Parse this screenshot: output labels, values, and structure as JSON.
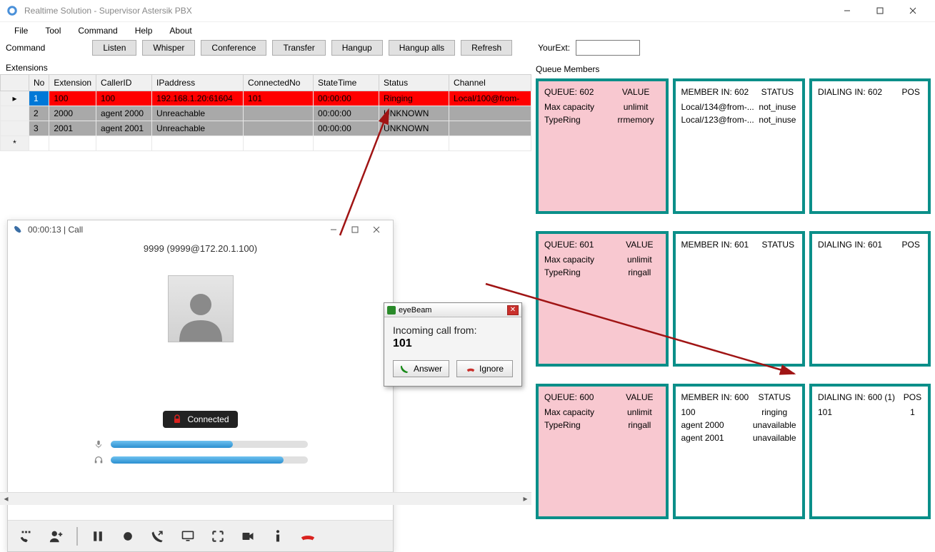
{
  "window": {
    "title": "Realtime Solution - Supervisor Astersik PBX"
  },
  "menubar": [
    "File",
    "Tool",
    "Command",
    "Help",
    "About"
  ],
  "toolbar": {
    "label": "Command",
    "listen": "Listen",
    "whisper": "Whisper",
    "conference": "Conference",
    "transfer": "Transfer",
    "hangup": "Hangup",
    "hangup_alls": "Hangup alls",
    "refresh": "Refresh",
    "yourext_label": "YourExt:",
    "yourext_value": ""
  },
  "extensions": {
    "label": "Extensions",
    "headers": [
      "No",
      "Extension",
      "CallerID",
      "IPaddress",
      "ConnectedNo",
      "StateTime",
      "Status",
      "Channel"
    ],
    "rows": [
      {
        "no": "1",
        "ext": "100",
        "cid": "100",
        "ip": "192.168.1.20:61604",
        "conn": "101",
        "time": "00:00:00",
        "status": "Ringing",
        "chan": "Local/100@from-"
      },
      {
        "no": "2",
        "ext": "2000",
        "cid": "agent 2000",
        "ip": "Unreachable",
        "conn": "",
        "time": "00:00:00",
        "status": "UNKNOWN",
        "chan": ""
      },
      {
        "no": "3",
        "ext": "2001",
        "cid": "agent 2001",
        "ip": "Unreachable",
        "conn": "",
        "time": "00:00:00",
        "status": "UNKNOWN",
        "chan": ""
      }
    ],
    "blank_marker": "*"
  },
  "softphone": {
    "title": "00:00:13 | Call",
    "caller": "9999 (9999@172.20.1.100)",
    "status": "Connected"
  },
  "popup": {
    "title": "eyeBeam",
    "label": "Incoming call from:",
    "number": "101",
    "answer": "Answer",
    "ignore": "Ignore"
  },
  "queue_members": {
    "label": "Queue Members",
    "rows": [
      {
        "queue": {
          "name": "QUEUE: 602",
          "value_hdr": "VALUE",
          "maxcap_lbl": "Max capacity",
          "maxcap_val": "unlimit",
          "typering_lbl": "TypeRing",
          "typering_val": "rrmemory"
        },
        "member": {
          "name": "MEMBER IN: 602",
          "status_hdr": "STATUS",
          "items": [
            {
              "m": "Local/134@from-...",
              "s": "not_inuse"
            },
            {
              "m": "Local/123@from-...",
              "s": "not_inuse"
            }
          ]
        },
        "dialing": {
          "name": "DIALING IN: 602",
          "pos_hdr": "POS",
          "items": []
        }
      },
      {
        "queue": {
          "name": "QUEUE: 601",
          "value_hdr": "VALUE",
          "maxcap_lbl": "Max capacity",
          "maxcap_val": "unlimit",
          "typering_lbl": "TypeRing",
          "typering_val": "ringall"
        },
        "member": {
          "name": "MEMBER IN: 601",
          "status_hdr": "STATUS",
          "items": []
        },
        "dialing": {
          "name": "DIALING IN: 601",
          "pos_hdr": "POS",
          "items": []
        }
      },
      {
        "queue": {
          "name": "QUEUE: 600",
          "value_hdr": "VALUE",
          "maxcap_lbl": "Max capacity",
          "maxcap_val": "unlimit",
          "typering_lbl": "TypeRing",
          "typering_val": "ringall"
        },
        "member": {
          "name": "MEMBER IN: 600",
          "status_hdr": "STATUS",
          "items": [
            {
              "m": "100",
              "s": "ringing"
            },
            {
              "m": "agent 2000",
              "s": "unavailable"
            },
            {
              "m": "agent 2001",
              "s": "unavailable"
            }
          ]
        },
        "dialing": {
          "name": "DIALING IN: 600 (1)",
          "pos_hdr": "POS",
          "items": [
            {
              "d": "101",
              "p": "1"
            }
          ]
        }
      }
    ]
  }
}
